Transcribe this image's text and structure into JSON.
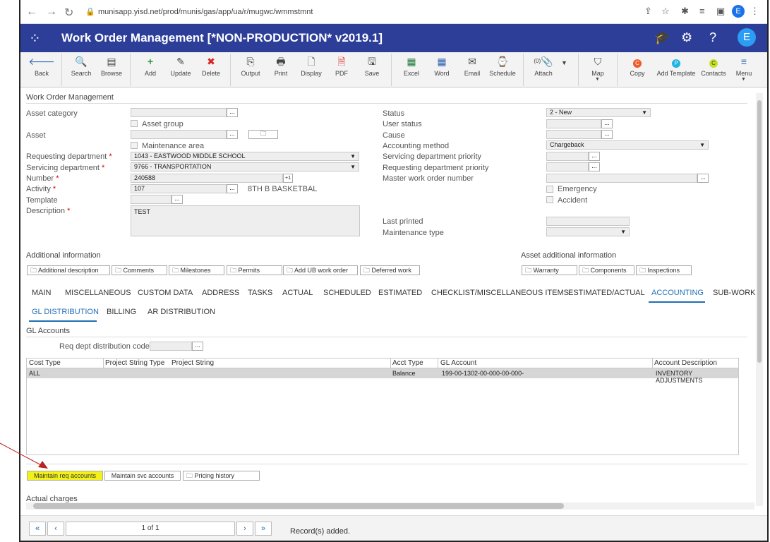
{
  "browser": {
    "url": "munisapp.yisd.net/prod/munis/gas/app/ua/r/mugwc/wmmstmnt",
    "profile_initial": "E"
  },
  "header": {
    "title": "Work Order Management [*NON-PRODUCTION* v2019.1]",
    "user_initial": "E",
    "brand_color": "#2d3e99"
  },
  "toolbar": {
    "items": [
      {
        "label": "Back",
        "icon": "back-arrow-icon"
      },
      {
        "label": "Search",
        "icon": "search-icon"
      },
      {
        "label": "Browse",
        "icon": "browse-icon"
      },
      {
        "label": "Add",
        "icon": "plus-icon"
      },
      {
        "label": "Update",
        "icon": "edit-icon"
      },
      {
        "label": "Delete",
        "icon": "delete-x-icon"
      },
      {
        "label": "Output",
        "icon": "output-icon"
      },
      {
        "label": "Print",
        "icon": "printer-icon"
      },
      {
        "label": "Display",
        "icon": "display-icon"
      },
      {
        "label": "PDF",
        "icon": "pdf-icon"
      },
      {
        "label": "Save",
        "icon": "save-icon"
      },
      {
        "label": "Excel",
        "icon": "excel-icon"
      },
      {
        "label": "Word",
        "icon": "word-icon"
      },
      {
        "label": "Email",
        "icon": "email-icon"
      },
      {
        "label": "Schedule",
        "icon": "schedule-icon"
      },
      {
        "label": "Attach",
        "icon": "paperclip-icon",
        "count": "(0)"
      },
      {
        "label": "Map",
        "icon": "map-icon"
      },
      {
        "label": "Copy",
        "icon": "copy-icon"
      },
      {
        "label": "Add Template",
        "icon": "add-template-icon"
      },
      {
        "label": "Contacts",
        "icon": "contacts-icon"
      },
      {
        "label": "Menu",
        "icon": "menu-icon"
      }
    ]
  },
  "form": {
    "section_title": "Work Order Management",
    "asset_category_label": "Asset category",
    "asset_group_label": "Asset group",
    "asset_label": "Asset",
    "maintenance_area_label": "Maintenance area",
    "requesting_department_label": "Requesting department",
    "requesting_department_value": "1043 - EASTWOOD MIDDLE SCHOOL",
    "servicing_department_label": "Servicing department",
    "servicing_department_value": "9766 - TRANSPORTATION",
    "number_label": "Number",
    "number_value": "240588",
    "number_suffix": "+1",
    "activity_label": "Activity",
    "activity_value": "107",
    "activity_desc": "8TH B BASKETBAL",
    "template_label": "Template",
    "description_label": "Description",
    "description_value": "TEST",
    "status_label": "Status",
    "status_value": "2 - New",
    "user_status_label": "User status",
    "cause_label": "Cause",
    "accounting_method_label": "Accounting method",
    "accounting_method_value": "Chargeback",
    "servicing_priority_label": "Servicing department priority",
    "requesting_priority_label": "Requesting department priority",
    "master_wo_label": "Master work order number",
    "emergency_label": "Emergency",
    "accident_label": "Accident",
    "last_printed_label": "Last printed",
    "maintenance_type_label": "Maintenance type"
  },
  "additional_info": {
    "title": "Additional information",
    "buttons": [
      "Additional description",
      "Comments",
      "Milestones",
      "Permits",
      "Add UB work order",
      "Deferred work"
    ]
  },
  "asset_additional_info": {
    "title": "Asset additional information",
    "buttons": [
      "Warranty",
      "Components",
      "Inspections"
    ]
  },
  "tabs": [
    "MAIN",
    "MISCELLANEOUS",
    "CUSTOM DATA",
    "ADDRESS",
    "TASKS",
    "ACTUAL",
    "SCHEDULED",
    "ESTIMATED",
    "CHECKLIST/MISCELLANEOUS ITEMS",
    "ESTIMATED/ACTUAL",
    "ACCOUNTING",
    "SUB-WORK"
  ],
  "active_tab": "ACCOUNTING",
  "subtabs": [
    "GL DISTRIBUTION",
    "BILLING",
    "AR DISTRIBUTION"
  ],
  "gl": {
    "section_title": "GL Accounts",
    "req_dept_label": "Req dept distribution code",
    "columns": [
      "Cost Type",
      "Project String Type",
      "Project String",
      "Acct Type",
      "GL Account",
      "Account Description"
    ],
    "rows": [
      [
        "ALL",
        "",
        "",
        "Balance",
        "199-00-1302-00-000-00-000-",
        "INVENTORY ADJUSTMENTS"
      ]
    ]
  },
  "bottom_buttons": [
    "Maintain req accounts",
    "Maintain svc accounts",
    "Pricing history"
  ],
  "actual_charges_label": "Actual charges",
  "footer": {
    "page_info": "1 of 1",
    "status": "Record(s) added."
  }
}
